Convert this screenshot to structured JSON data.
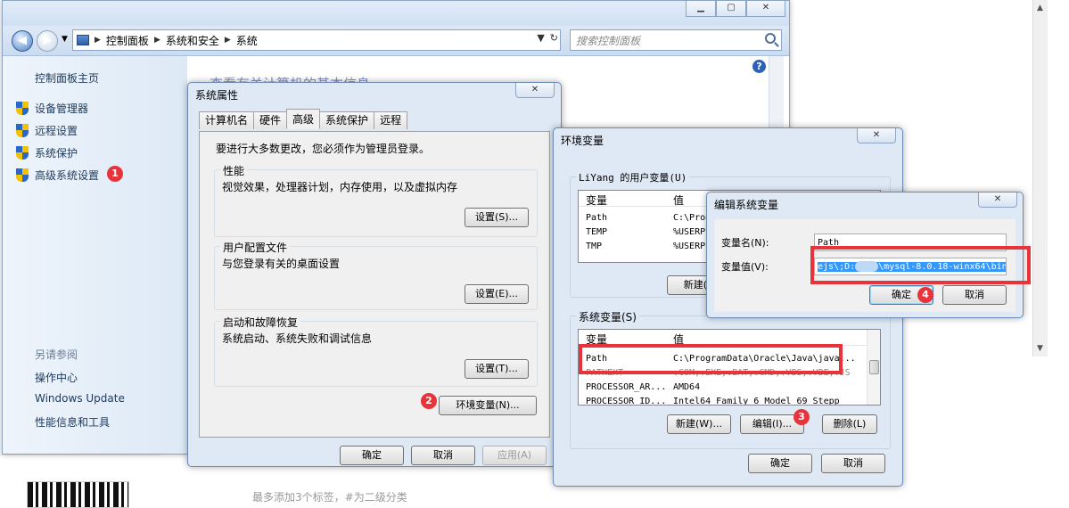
{
  "background": {
    "bottom_hint": "最多添加3个标签，#为二级分类"
  },
  "control_panel": {
    "breadcrumbs": [
      "控制面板",
      "系统和安全",
      "系统"
    ],
    "search_placeholder": "搜索控制面板",
    "sidebar_home": "控制面板主页",
    "sidebar_items": [
      "设备管理器",
      "远程设置",
      "系统保护",
      "高级系统设置"
    ],
    "see_also_title": "另请参阅",
    "see_also_links": [
      "操作中心",
      "Windows Update",
      "性能信息和工具"
    ],
    "main_title": "查看有关计算机的基本信息"
  },
  "sys_props": {
    "title": "系统属性",
    "tabs": [
      "计算机名",
      "硬件",
      "高级",
      "系统保护",
      "远程"
    ],
    "active_tab": "高级",
    "admin_note": "要进行大多数更改，您必须作为管理员登录。",
    "perf_title": "性能",
    "perf_desc": "视觉效果，处理器计划，内存使用，以及虚拟内存",
    "perf_btn": "设置(S)...",
    "profile_title": "用户配置文件",
    "profile_desc": "与您登录有关的桌面设置",
    "profile_btn": "设置(E)...",
    "startup_title": "启动和故障恢复",
    "startup_desc": "系统启动、系统失败和调试信息",
    "startup_btn": "设置(T)...",
    "env_btn": "环境变量(N)...",
    "ok": "确定",
    "cancel": "取消",
    "apply": "应用(A)"
  },
  "env_vars": {
    "title": "环境变量",
    "user_group": "LiYang 的用户变量(U)",
    "columns": [
      "变量",
      "值"
    ],
    "user_rows": [
      {
        "name": "Path",
        "value": "C:\\Prog"
      },
      {
        "name": "TEMP",
        "value": "%USERP"
      },
      {
        "name": "TMP",
        "value": "%USERP"
      }
    ],
    "user_new_btn": "新建(N",
    "sys_group": "系统变量(S)",
    "sys_rows": [
      {
        "name": "Path",
        "value": "C:\\ProgramData\\Oracle\\Java\\java..."
      },
      {
        "name": "PATHEXT",
        "value": ".COM;.EXE;.BAT;.CMD;.VBS;.VBE;.JS"
      },
      {
        "name": "PROCESSOR_AR...",
        "value": "AMD64"
      },
      {
        "name": "PROCESSOR_ID...",
        "value": "Intel64 Family 6 Model 69 Stepp"
      }
    ],
    "sys_new_btn": "新建(W)...",
    "sys_edit_btn": "编辑(I)...",
    "sys_delete_btn": "删除(L)",
    "ok": "确定",
    "cancel": "取消"
  },
  "edit_var": {
    "title": "编辑系统变量",
    "name_label": "变量名(N):",
    "name_value": "Path",
    "value_label": "变量值(V):",
    "value_prefix": "ejs\\;D:",
    "value_suffix": "\\mysql-8.0.18-winx64\\bin",
    "ok": "确定",
    "cancel": "取消"
  },
  "annotations": [
    "1",
    "2",
    "3",
    "4"
  ],
  "colors": {
    "annotation_red": "#e8333a",
    "selection_blue": "#3399ff",
    "dialog_frame": "#dfe9f5"
  }
}
